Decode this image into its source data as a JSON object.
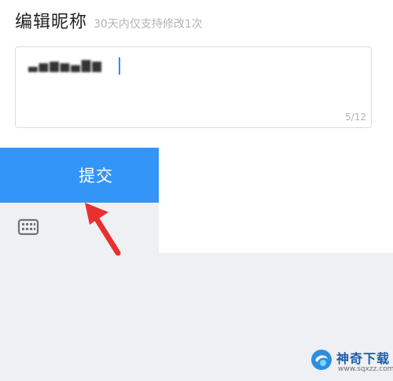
{
  "header": {
    "title": "编辑昵称",
    "hint": "30天内仅支持修改1次"
  },
  "nickname_input": {
    "value": "▃▅▆▅▄▇▆",
    "counter": "5/12"
  },
  "submit": {
    "label": "提交"
  },
  "icons": {
    "keyboard": "keyboard-icon",
    "arrow": "red-arrow-icon"
  },
  "colors": {
    "accent": "#3295f7",
    "arrow": "#e8312f"
  },
  "watermark": {
    "name": "神奇下载",
    "url": "www.sqxzz.com"
  }
}
